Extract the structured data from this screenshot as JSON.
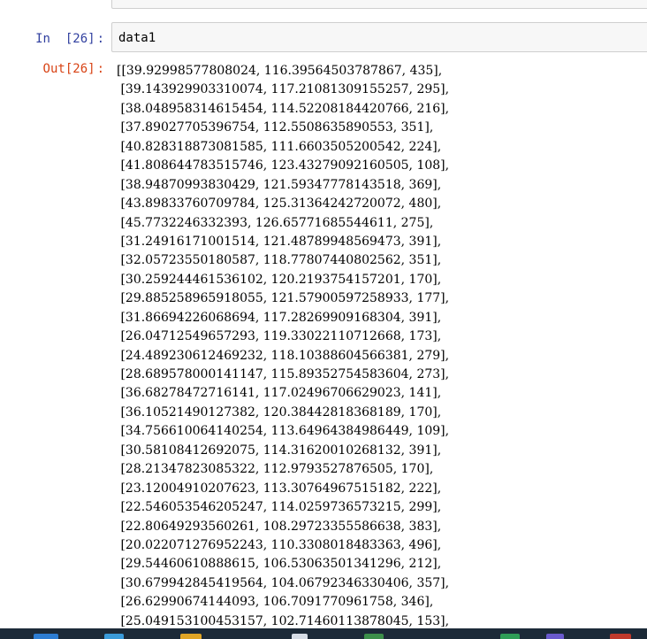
{
  "notebook": {
    "input_cell": {
      "prompt_label": "In",
      "prompt_number": "[26]",
      "prompt_sep": ":",
      "code": "data1"
    },
    "output_cell": {
      "prompt_label": "Out",
      "prompt_number": "[26]",
      "prompt_sep": ":",
      "lines": [
        "[[39.92998577808024, 116.39564503787867, 435],",
        " [39.143929903310074, 117.21081309155257, 295],",
        " [38.048958314615454, 114.52208184420766, 216],",
        " [37.89027705396754, 112.5508635890553, 351],",
        " [40.828318873081585, 111.6603505200542, 224],",
        " [41.808644783515746, 123.43279092160505, 108],",
        " [38.94870993830429, 121.59347778143518, 369],",
        " [43.89833760709784, 125.31364242720072, 480],",
        " [45.7732246332393, 126.65771685544611, 275],",
        " [31.24916171001514, 121.48789948569473, 391],",
        " [32.05723550180587, 118.77807440802562, 351],",
        " [30.259244461536102, 120.2193754157201, 170],",
        " [29.885258965918055, 121.57900597258933, 177],",
        " [31.86694226068694, 117.28269909168304, 391],",
        " [26.04712549657293, 119.33022110712668, 173],",
        " [24.489230612469232, 118.10388604566381, 279],",
        " [28.689578000141147, 115.89352754583604, 273],",
        " [36.68278472716141, 117.02496706629023, 141],",
        " [36.10521490127382, 120.38442818368189, 170],",
        " [34.756610064140254, 113.64964384986449, 109],",
        " [30.58108412692075, 114.31620010268132, 391],",
        " [28.21347823085322, 112.9793527876505, 170],",
        " [23.12004910207623, 113.30764967515182, 222],",
        " [22.546053546205247, 114.0259736573215, 299],",
        " [22.80649293560261, 108.29723355586638, 383],",
        " [20.022071276952243, 110.3308018483363, 496],",
        " [29.54460610888615, 106.53063501341296, 212],",
        " [30.679942845419564, 104.06792346330406, 357],",
        " [26.62990674144093, 106.7091770961758, 346],",
        " [25.049153100453157, 102.71460113878045, 153],"
      ]
    }
  },
  "colors": {
    "in_prompt": "#303f9f",
    "out_prompt": "#d84315",
    "cell_border": "#cfcfcf",
    "cell_bg": "#f7f7f7",
    "taskbar": "#1c2a38"
  }
}
